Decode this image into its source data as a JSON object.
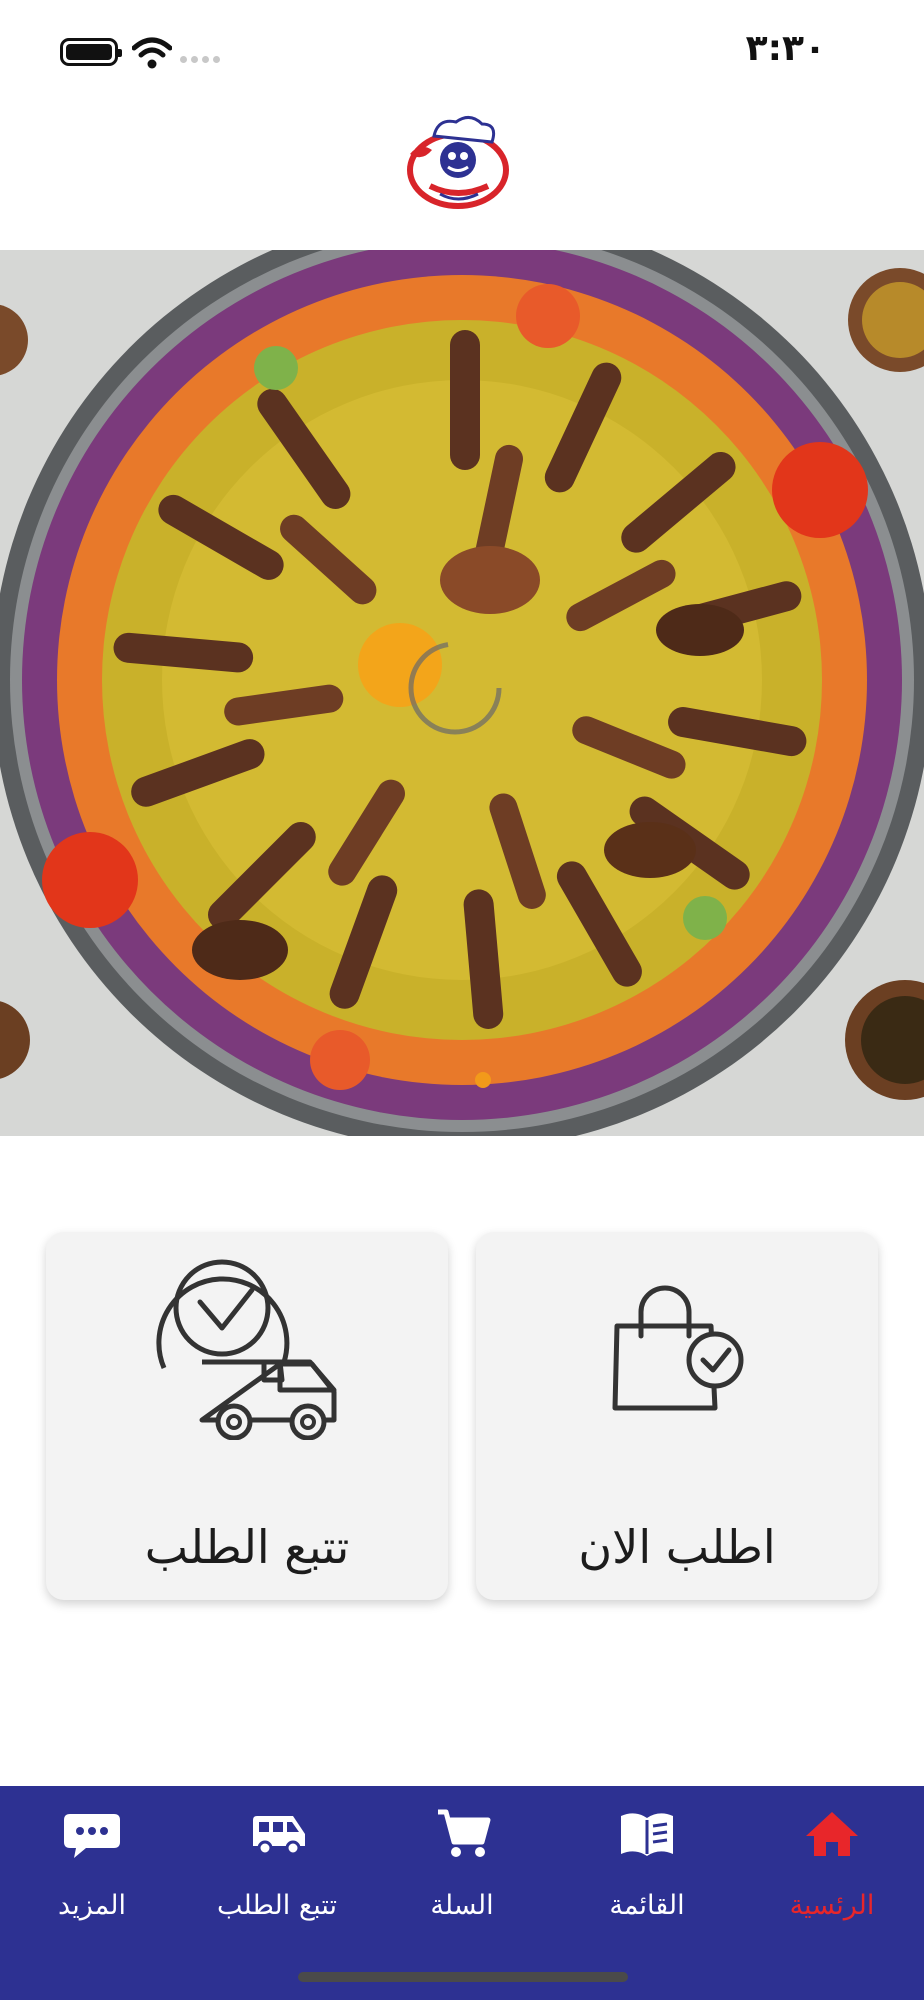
{
  "status_bar": {
    "time": "٣:٣٠",
    "icons": [
      "battery-icon",
      "wifi-icon",
      "signal-icon"
    ]
  },
  "logo": {
    "icon": "chef-logo-icon"
  },
  "hero": {
    "icon": "food-platter-image",
    "carousel_indicator_active": 1
  },
  "actions": {
    "track_order": {
      "label": "تتبع الطلب",
      "icon": "clock-delivery-truck-icon"
    },
    "order_now": {
      "label": "اطلب الان",
      "icon": "shopping-bag-check-icon"
    }
  },
  "nav": {
    "items": [
      {
        "label": "الرئسية",
        "icon": "home-icon",
        "active": true
      },
      {
        "label": "القائمة",
        "icon": "menu-book-icon",
        "active": false
      },
      {
        "label": "السلة",
        "icon": "cart-icon",
        "active": false
      },
      {
        "label": "تتبع الطلب",
        "icon": "bus-icon",
        "active": false
      },
      {
        "label": "المزيد",
        "icon": "more-chat-icon",
        "active": false
      }
    ]
  },
  "colors": {
    "nav_background": "#2d3192",
    "nav_active": "#e8262a",
    "card_background": "#f3f3f3"
  }
}
